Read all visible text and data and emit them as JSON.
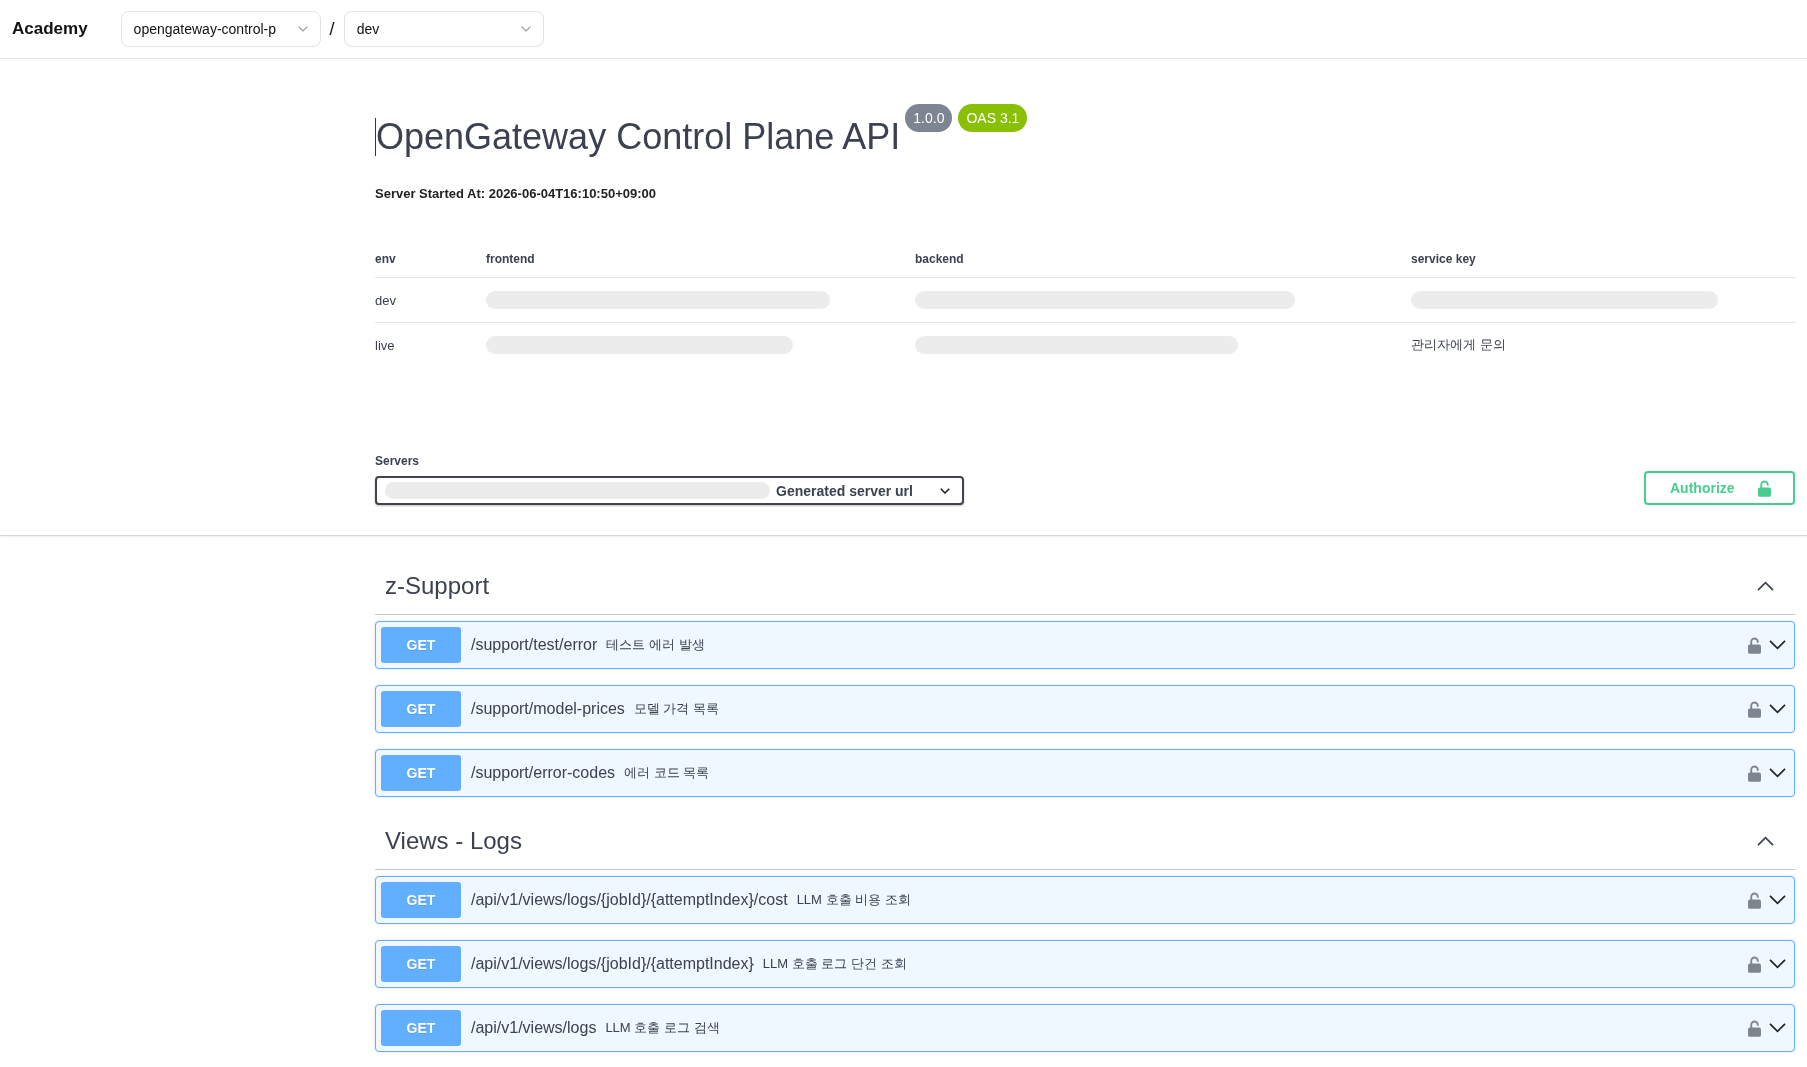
{
  "top_bar": {
    "brand": "Academy",
    "project_select": {
      "value": "opengateway-control-p"
    },
    "separator": "/",
    "environment_select": {
      "value": "dev"
    }
  },
  "info": {
    "title": "OpenGateway Control Plane API",
    "version": "1.0.0",
    "spec_version": "OAS 3.1",
    "server_started": "Server Started At: 2026-06-04T16:10:50+09:00"
  },
  "environments_table": {
    "columns": [
      "env",
      "frontend",
      "backend",
      "service key"
    ],
    "rows": [
      [
        {
          "kind": "text",
          "text": "dev"
        },
        {
          "kind": "redacted"
        },
        {
          "kind": "redacted"
        },
        {
          "kind": "redacted"
        }
      ],
      [
        {
          "kind": "text",
          "text": "live"
        },
        {
          "kind": "redacted"
        },
        {
          "kind": "redacted"
        },
        {
          "kind": "text",
          "text": "관리자에게 문의"
        }
      ]
    ]
  },
  "servers": {
    "label": "Servers",
    "select": {
      "redacted": true,
      "value": "Generated server url"
    }
  },
  "authorize_button": {
    "label": "Authorize",
    "authorized": false
  },
  "sections": [
    {
      "name": "z-Support",
      "expanded": true,
      "operations": [
        {
          "method": "GET",
          "path": "/support/test/error",
          "summary": "테스트 에러 발생",
          "locked": false,
          "expanded": false
        },
        {
          "method": "GET",
          "path": "/support/model-prices",
          "summary": "모델 가격 목록",
          "locked": false,
          "expanded": false
        },
        {
          "method": "GET",
          "path": "/support/error-codes",
          "summary": "에러 코드 목록",
          "locked": false,
          "expanded": false
        }
      ]
    },
    {
      "name": "Views - Logs",
      "expanded": true,
      "operations": [
        {
          "method": "GET",
          "path": "/api/v1/views/logs/{jobId}/{attemptIndex}/cost",
          "summary": "LLM 호출 비용 조회",
          "locked": false,
          "expanded": false
        },
        {
          "method": "GET",
          "path": "/api/v1/views/logs/{jobId}/{attemptIndex}",
          "summary": "LLM 호출 로그 단건 조회",
          "locked": false,
          "expanded": false
        },
        {
          "method": "GET",
          "path": "/api/v1/views/logs",
          "summary": "LLM 호출 로그 검색",
          "locked": false,
          "expanded": false
        }
      ]
    }
  ]
}
